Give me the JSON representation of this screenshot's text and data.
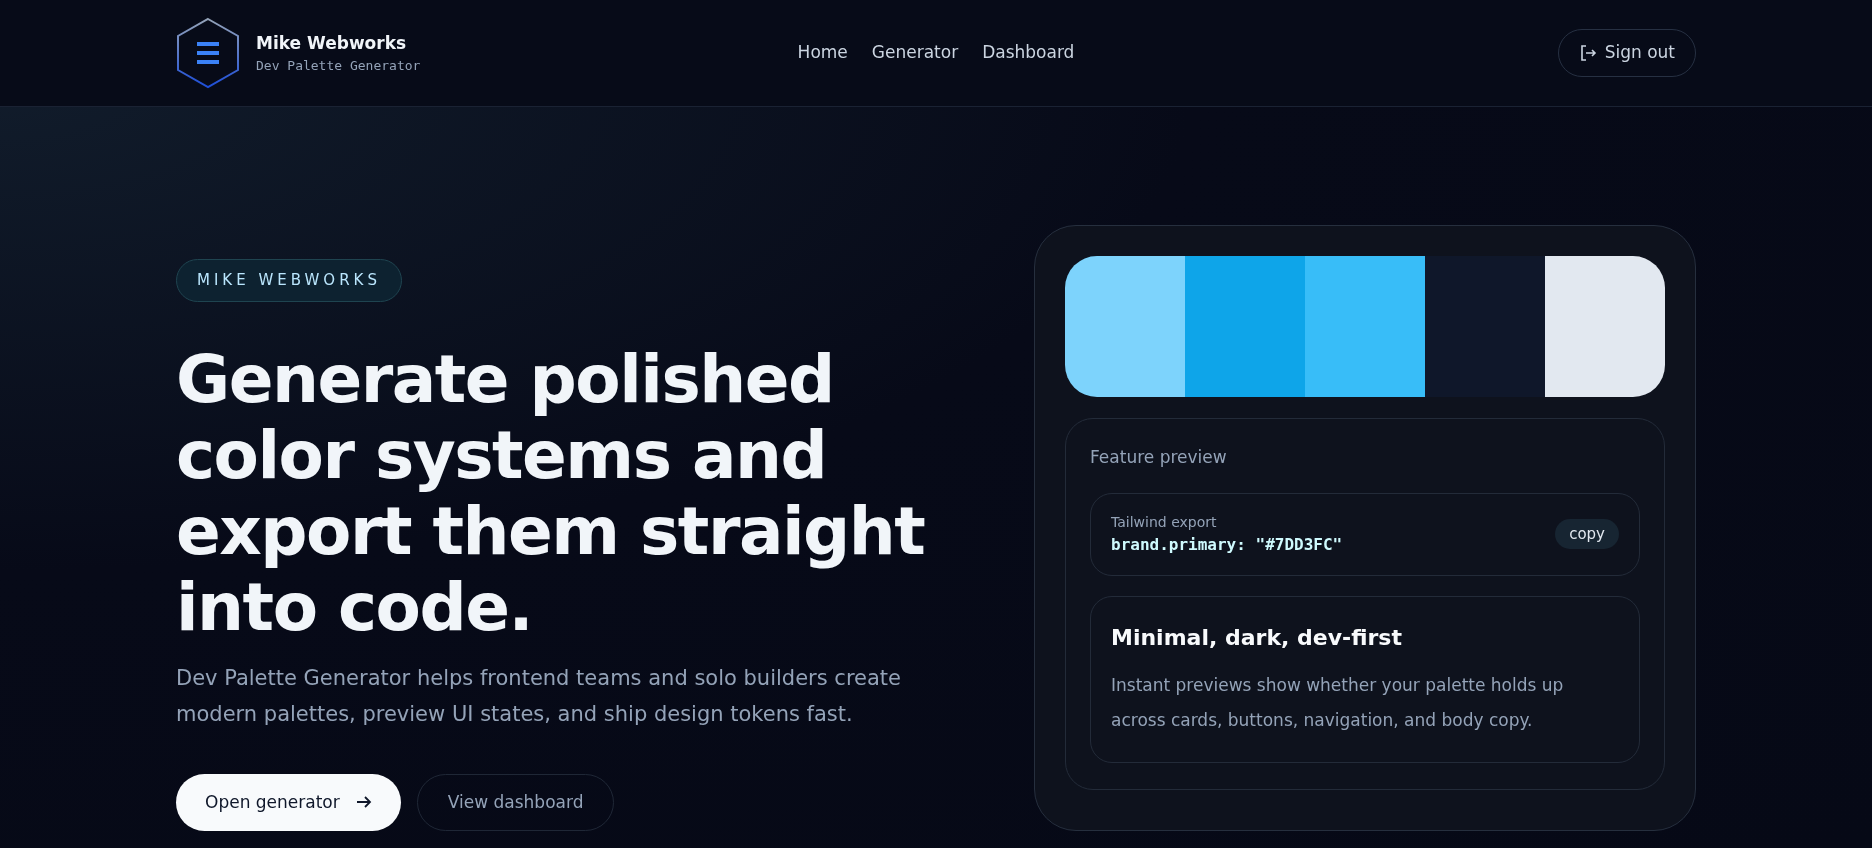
{
  "brand": {
    "name": "Mike Webworks",
    "subtitle": "Dev Palette Generator"
  },
  "nav": [
    {
      "label": "Home"
    },
    {
      "label": "Generator"
    },
    {
      "label": "Dashboard"
    }
  ],
  "sign_out": {
    "label": "Sign out"
  },
  "hero": {
    "eyebrow": "MIKE WEBWORKS",
    "heading": "Generate polished color systems and export them straight into code.",
    "lead": "Dev Palette Generator helps frontend teams and solo builders create modern palettes, preview UI states, and ship design tokens fast.",
    "buttons": [
      {
        "label": "Open generator",
        "kind": "primary"
      },
      {
        "label": "View dashboard",
        "kind": "outline"
      }
    ]
  },
  "preview": {
    "swatches": [
      {
        "color": "#7dd3fc"
      },
      {
        "color": "#0ea5e9"
      },
      {
        "color": "#38bdf8"
      },
      {
        "color": "#0f172a"
      },
      {
        "color": "#e2e8f0"
      }
    ],
    "title": "Feature preview",
    "export": {
      "label": "Tailwind export",
      "code": "brand.primary: \"#7DD3FC\"",
      "button": "copy"
    },
    "feature": {
      "heading": "Minimal, dark, dev-first",
      "text": "Instant previews show whether your palette holds up across cards, buttons, navigation, and body copy."
    }
  }
}
